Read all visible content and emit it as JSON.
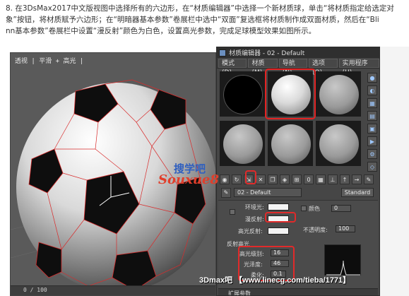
{
  "instruction": {
    "line1": "8. 在3DsMax2017中文版视图中选择所有的六边形，在“材质编辑器”中选择一个新材质球，单击“将材质指定给选定对",
    "line2": "象”按钮，将材质赋予六边形；在“明暗器基本参数”卷展栏中选中“双面”复选框将材质制作成双面材质，然后在“Bli",
    "line3": "nn基本参数”卷展栏中设置“漫反射”颜色为白色，设置高光参数，完成足球模型效果如图所示。"
  },
  "viewport": {
    "label": "透视 | 平滑 + 高光 |",
    "frame": "0 / 100"
  },
  "material_editor": {
    "title": "材质编辑器 - 02 - Default",
    "menus": [
      "模式(D)",
      "材质(M)",
      "导航(N)",
      "选项(O)",
      "实用程序(U)"
    ],
    "material_name": "02 - Default",
    "material_type": "Standard",
    "params": {
      "ambient_label": "环境光:",
      "diffuse_label": "漫反射:",
      "specular_label": "高光反射:",
      "color_label": "颜色",
      "color_value": "0",
      "opacity_label": "不透明度:",
      "opacity_value": "100",
      "specular_group": "反射高光",
      "spec_level_label": "高光级别:",
      "spec_level_value": "16",
      "glossiness_label": "光泽度:",
      "glossiness_value": "46",
      "soften_label": "柔化:",
      "soften_value": "0.1",
      "rollout_label": "扩展参数"
    }
  },
  "watermarks": {
    "brand": "搜学吧",
    "site": "Souxue8",
    "footer": "3Dmax吧 【www.linecg.com/tieba/1771】"
  },
  "colors": {
    "highlight": "#e12a2a",
    "diffuse": "#ffffff"
  }
}
